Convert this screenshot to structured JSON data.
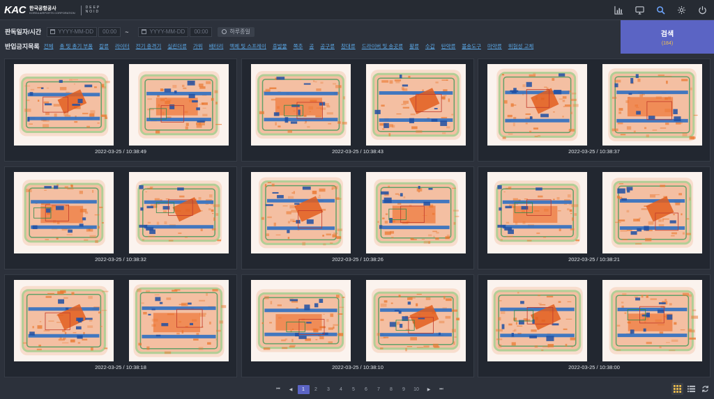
{
  "header": {
    "logo_text": "KAC",
    "logo_kr": "한국공항공사",
    "logo_kr_sub": "KOREA AIRPORTS CORPORATION",
    "partner_line1": "DEEP",
    "partner_line2": "NOID",
    "icons": [
      "chart-icon",
      "monitor-icon",
      "search-icon",
      "gear-icon",
      "power-icon"
    ]
  },
  "filter": {
    "datetime_label": "판독일자/시간",
    "from_date_placeholder": "YYYY-MM-DD",
    "from_time_placeholder": "00:00",
    "separator": "~",
    "to_date_placeholder": "YYYY-MM-DD",
    "to_time_placeholder": "00:00",
    "one_day_label": "하루종일",
    "categories_label": "반입금지목록",
    "categories": [
      "전체",
      "총 및 총기 부품",
      "칼류",
      "라이터",
      "전기 충격기",
      "실린더류",
      "가위",
      "배터리",
      "액체 및 스프레이",
      "휴발물",
      "쪽추",
      "공",
      "공구류",
      "창대류",
      "드라이버 및 송곳류",
      "활류",
      "수갑",
      "탄약류",
      "볼송도구",
      "마약류",
      "위험성 고체"
    ]
  },
  "search": {
    "label": "검색",
    "count": "(184)"
  },
  "results": [
    {
      "timestamp": "2022-03-25 / 10:38:49"
    },
    {
      "timestamp": "2022-03-25 / 10:38:43"
    },
    {
      "timestamp": "2022-03-25 / 10:38:37"
    },
    {
      "timestamp": "2022-03-25 / 10:38:32"
    },
    {
      "timestamp": "2022-03-25 / 10:38:26"
    },
    {
      "timestamp": "2022-03-25 / 10:38:21"
    },
    {
      "timestamp": "2022-03-25 / 10:38:18"
    },
    {
      "timestamp": "2022-03-25 / 10:38:10"
    },
    {
      "timestamp": "2022-03-25 / 10:38:00"
    }
  ],
  "pagination": {
    "first": "⏮",
    "prev": "◀",
    "next": "▶",
    "last": "⏭",
    "pages": [
      "1",
      "2",
      "3",
      "4",
      "5",
      "6",
      "7",
      "8",
      "9",
      "10"
    ],
    "current": "1"
  },
  "view": {
    "grid_icon": "grid-view-icon",
    "list_icon": "list-view-icon",
    "refresh_icon": "refresh-icon"
  },
  "colors": {
    "accent": "#5b64c4",
    "link": "#5aa7e6",
    "count": "#f2c14e",
    "background": "#2c313b"
  }
}
